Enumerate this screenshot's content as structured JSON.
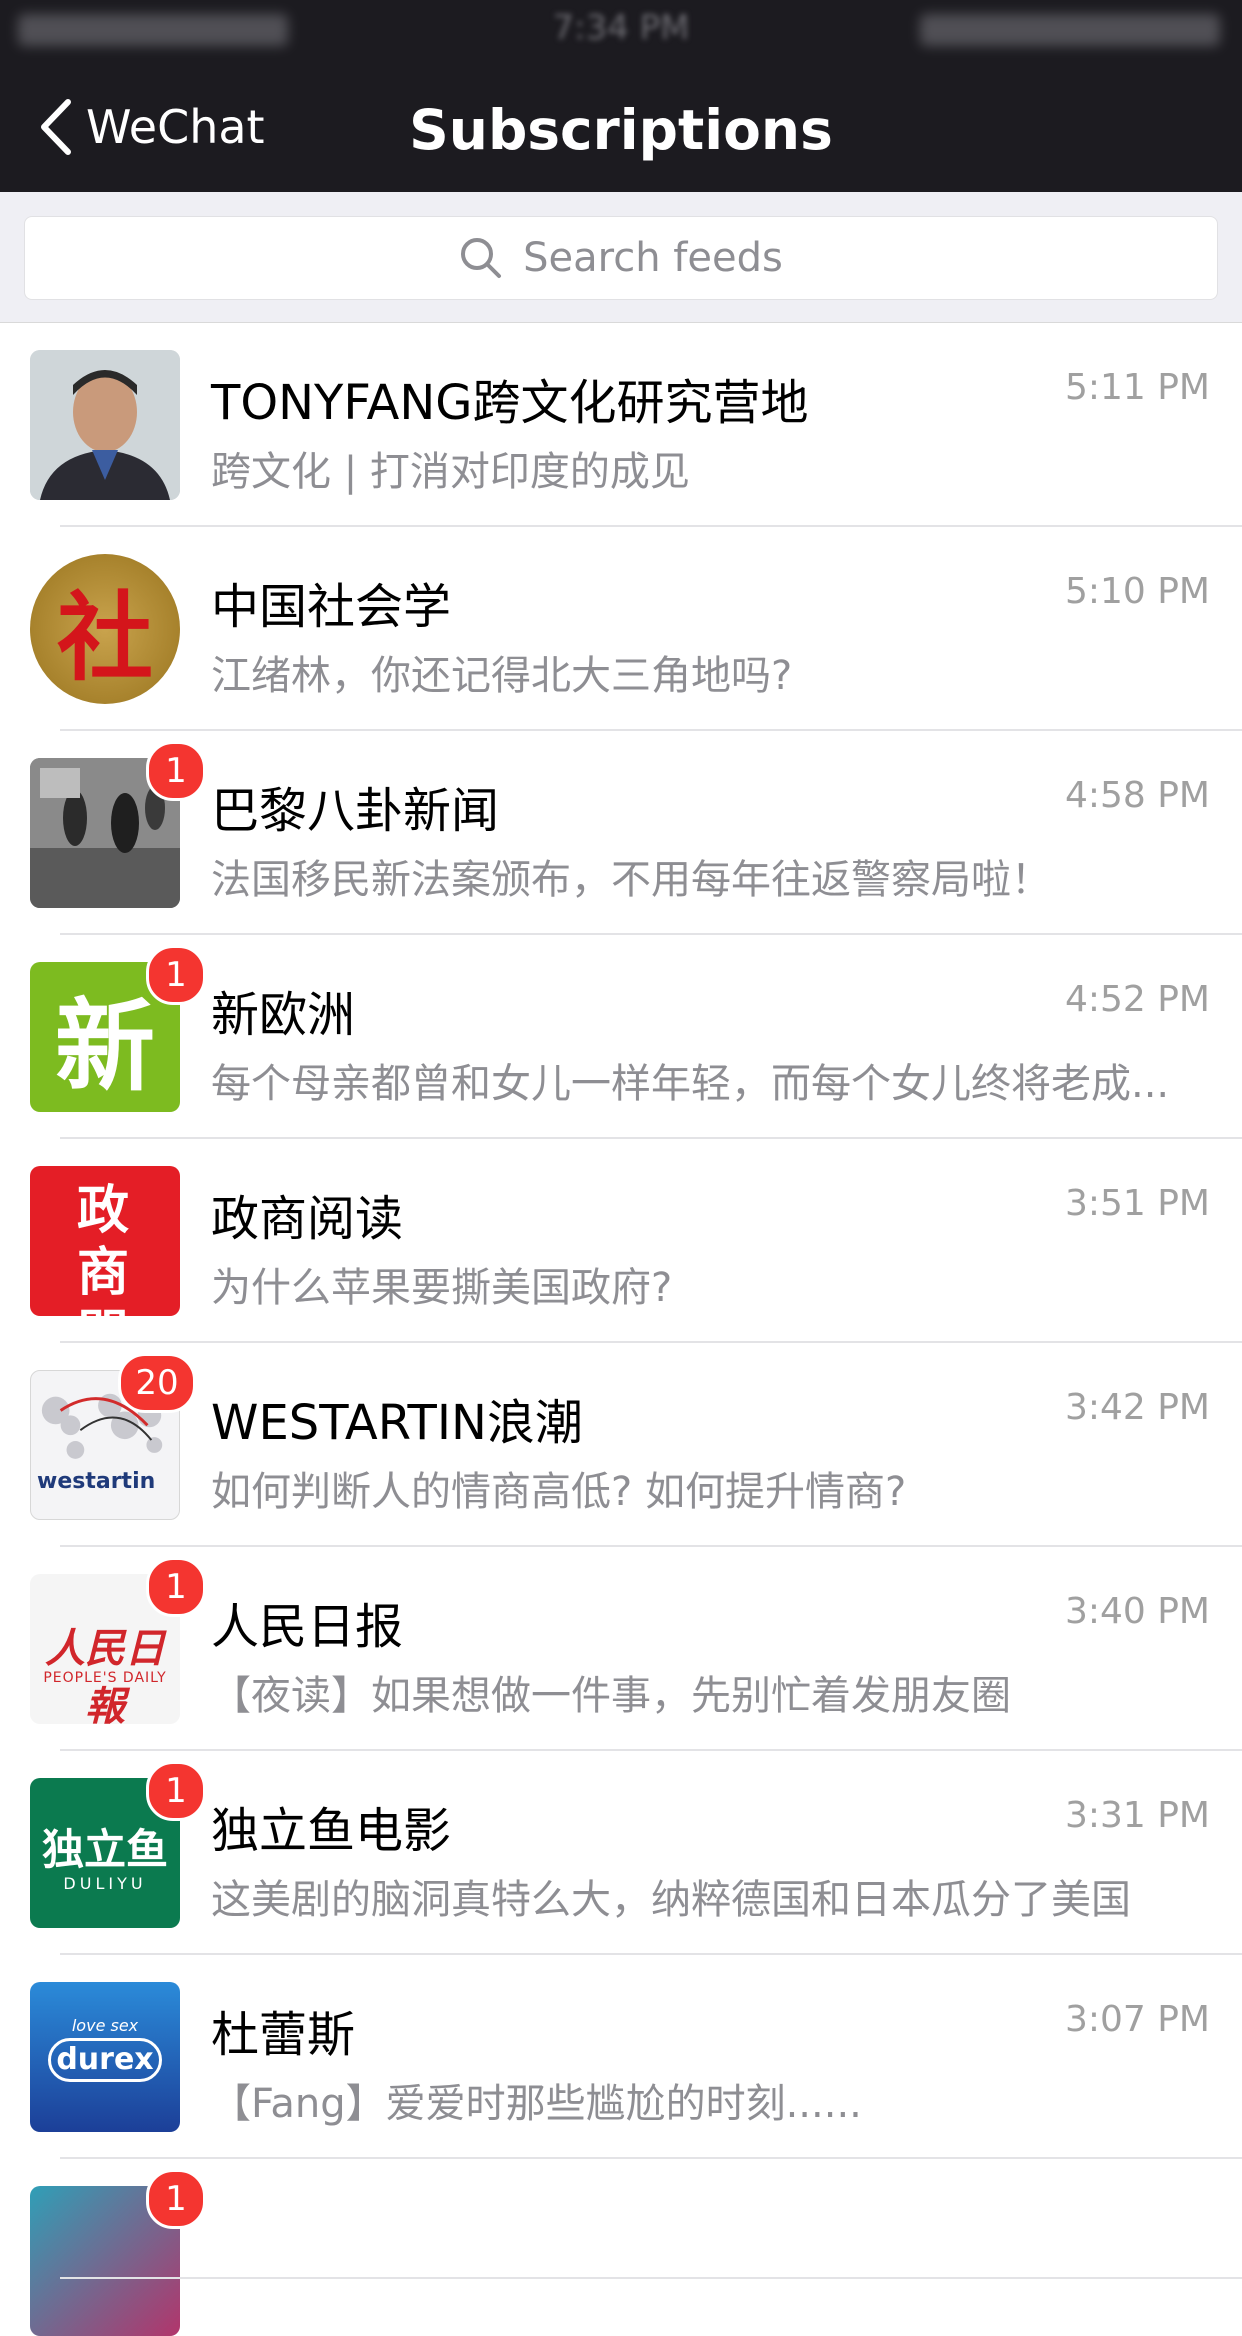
{
  "nav": {
    "back_label": "WeChat",
    "title": "Subscriptions"
  },
  "search": {
    "placeholder": "Search feeds"
  },
  "feeds": [
    {
      "name": "TONYFANG跨文化研究营地",
      "time": "5:11 PM",
      "preview": "跨文化 | 打消对印度的成见",
      "badge": ""
    },
    {
      "name": "中国社会学",
      "time": "5:10 PM",
      "preview": "江绪林，你还记得北大三角地吗?",
      "badge": ""
    },
    {
      "name": "巴黎八卦新闻",
      "time": "4:58 PM",
      "preview": "法国移民新法案颁布，不用每年往返警察局啦！",
      "badge": "1"
    },
    {
      "name": "新欧洲",
      "time": "4:52 PM",
      "preview": "每个母亲都曾和女儿一样年轻，而每个女儿终将老成...",
      "badge": "1"
    },
    {
      "name": "政商阅读",
      "time": "3:51 PM",
      "preview": "为什么苹果要撕美国政府?",
      "badge": ""
    },
    {
      "name": "WESTARTIN浪潮",
      "time": "3:42 PM",
      "preview": "如何判断人的情商高低? 如何提升情商?",
      "badge": "20"
    },
    {
      "name": "人民日报",
      "time": "3:40 PM",
      "preview": "【夜读】如果想做一件事，先别忙着发朋友圈",
      "badge": "1"
    },
    {
      "name": "独立鱼电影",
      "time": "3:31 PM",
      "preview": "这美剧的脑洞真特么大，纳粹德国和日本瓜分了美国",
      "badge": "1"
    },
    {
      "name": "杜蕾斯",
      "time": "3:07 PM",
      "preview": "【Fang】爱爱时那些尴尬的时刻......",
      "badge": ""
    }
  ],
  "partial_badge": "1",
  "avatar_text": {
    "seal": "社",
    "green": "新",
    "red": "政商閱讀",
    "westartin": "westartin",
    "people_cn": "人民日報",
    "people_en": "PEOPLE'S DAILY",
    "duliyu_cn": "独立鱼",
    "duliyu_en": "DULIYU",
    "durex_top": "love sex",
    "durex": "durex"
  }
}
